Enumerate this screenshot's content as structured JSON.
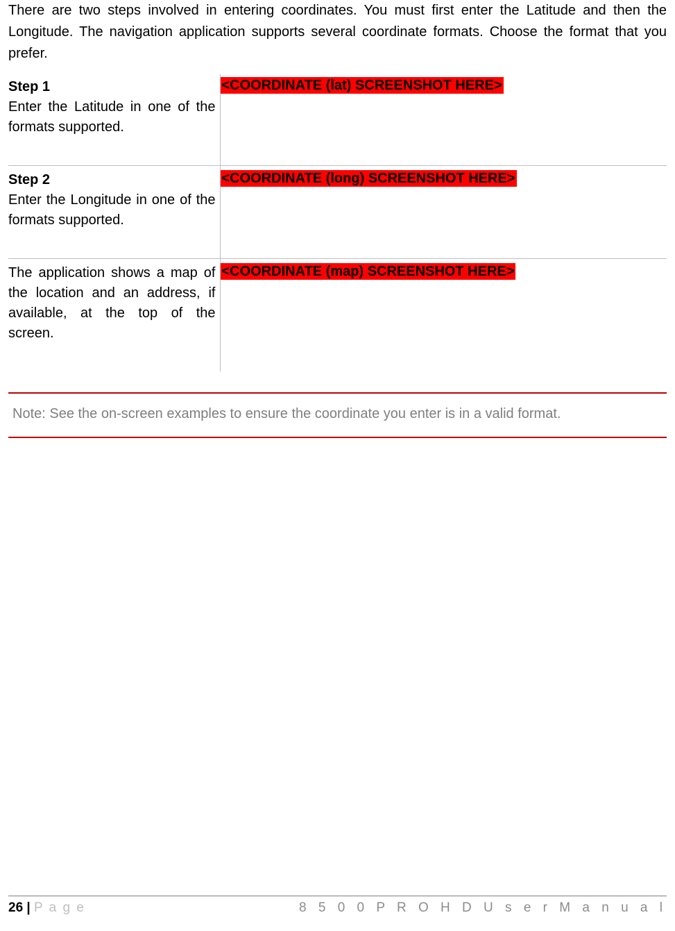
{
  "intro": "There are two steps involved in entering coordinates. You must first enter the Latitude and then the Longitude. The navigation application supports several coordinate formats. Choose the format that you prefer.",
  "rows": [
    {
      "title": "Step 1",
      "desc": "Enter the Latitude in one of the formats supported.",
      "placeholder": "<COORDINATE (lat) SCREENSHOT HERE>"
    },
    {
      "title": "Step 2",
      "desc": "Enter the Longitude in one of the formats supported.",
      "placeholder": "<COORDINATE (long) SCREENSHOT HERE>"
    },
    {
      "title": "",
      "desc": "The application shows a map of the location and an address, if available, at the top of the screen.",
      "placeholder": "<COORDINATE (map) SCREENSHOT HERE>"
    }
  ],
  "note": "Note: See the on-screen examples to ensure the coordinate you enter is in a valid format.",
  "footer": {
    "pageNumber": "26",
    "separator": " | ",
    "pageWord": "P a g e",
    "manualTitle": "8 5 0 0  P R O  H D  U s e r  M a n u a l"
  }
}
